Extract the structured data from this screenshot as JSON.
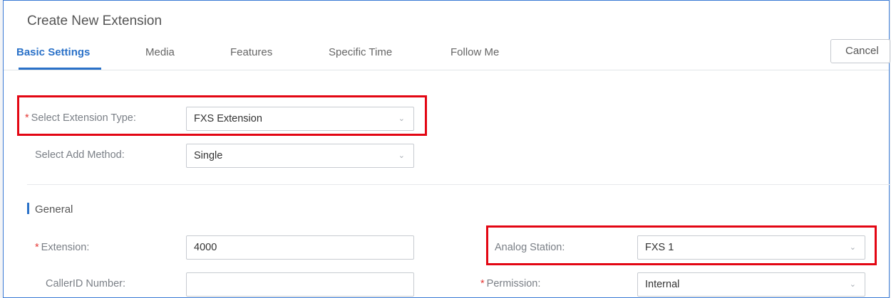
{
  "window": {
    "title": "Create New Extension"
  },
  "tabs": [
    {
      "label": "Basic Settings",
      "active": true
    },
    {
      "label": "Media"
    },
    {
      "label": "Features"
    },
    {
      "label": "Specific Time"
    },
    {
      "label": "Follow Me"
    }
  ],
  "toolbar": {
    "cancel_label": "Cancel"
  },
  "form": {
    "extension_type": {
      "label": "Select Extension Type:",
      "required": true,
      "value": "FXS Extension"
    },
    "add_method": {
      "label": "Select Add Method:",
      "value": "Single"
    },
    "general_section": "General",
    "extension": {
      "label": "Extension:",
      "required": true,
      "value": "4000"
    },
    "callerid": {
      "label": "CallerID Number:",
      "value": ""
    },
    "analog_station": {
      "label": "Analog Station:",
      "value": "FXS 1"
    },
    "permission": {
      "label": "Permission:",
      "required": true,
      "value": "Internal"
    }
  },
  "icons": {
    "dropdown": "chevron-down-icon",
    "required_marker": "*"
  },
  "colors": {
    "accent": "#2a71c8",
    "highlight": "#e30613",
    "required": "#e53935"
  }
}
